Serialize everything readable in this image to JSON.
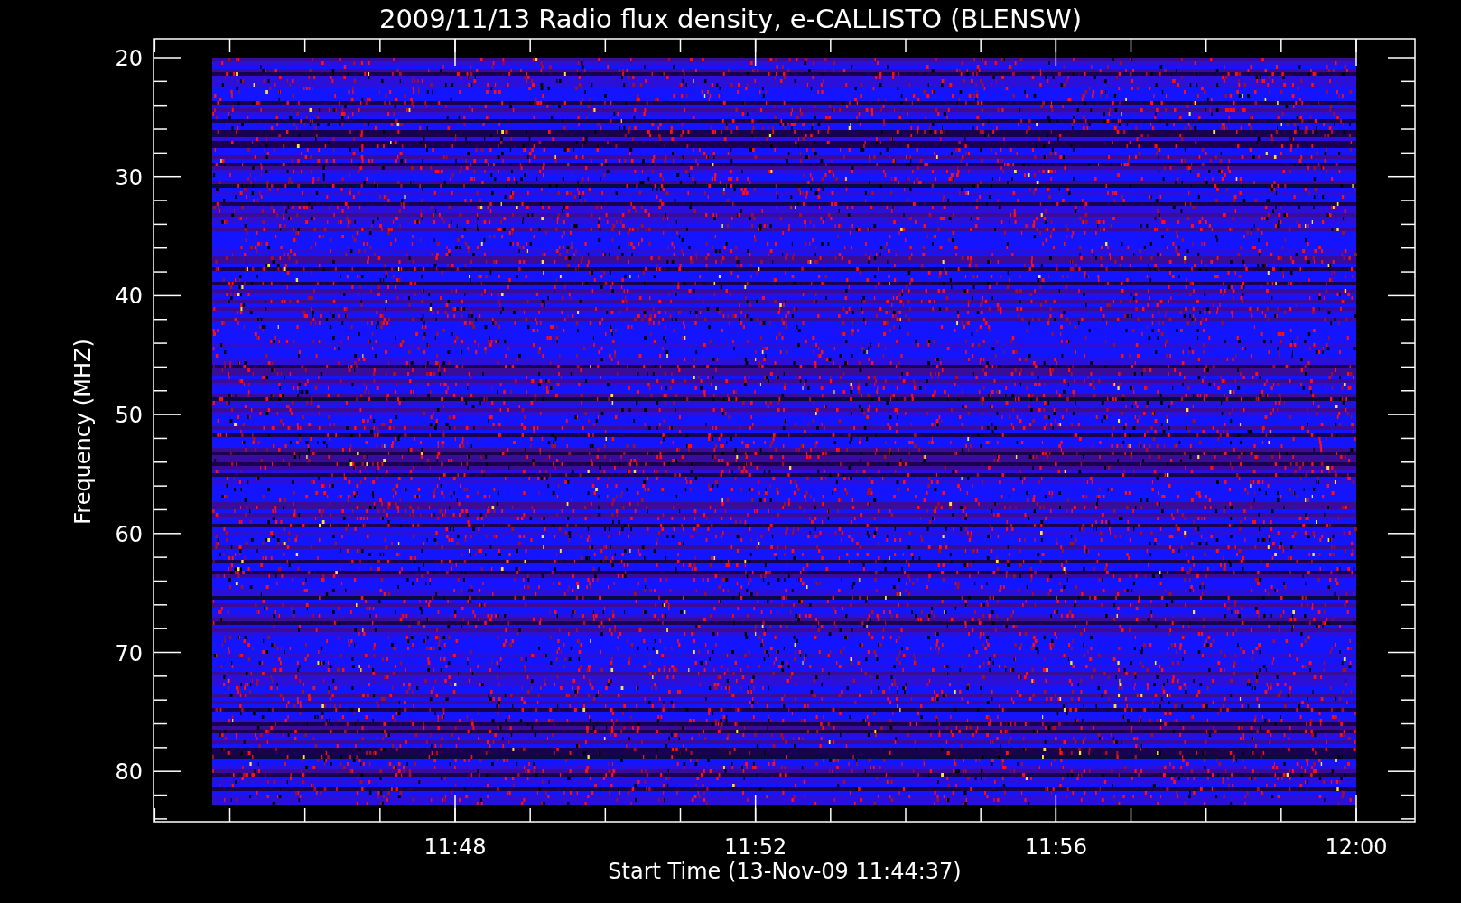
{
  "title": "2009/11/13  Radio flux density, e-CALLISTO (BLENSW)",
  "y_axis": {
    "label": "Frequency (MHZ)",
    "ticks": [
      "20",
      "30",
      "40",
      "50",
      "60",
      "70",
      "80"
    ]
  },
  "x_axis": {
    "label": "Start Time (13-Nov-09 11:44:37)",
    "ticks": [
      "11:48",
      "11:52",
      "11:56",
      "12:00"
    ]
  }
}
